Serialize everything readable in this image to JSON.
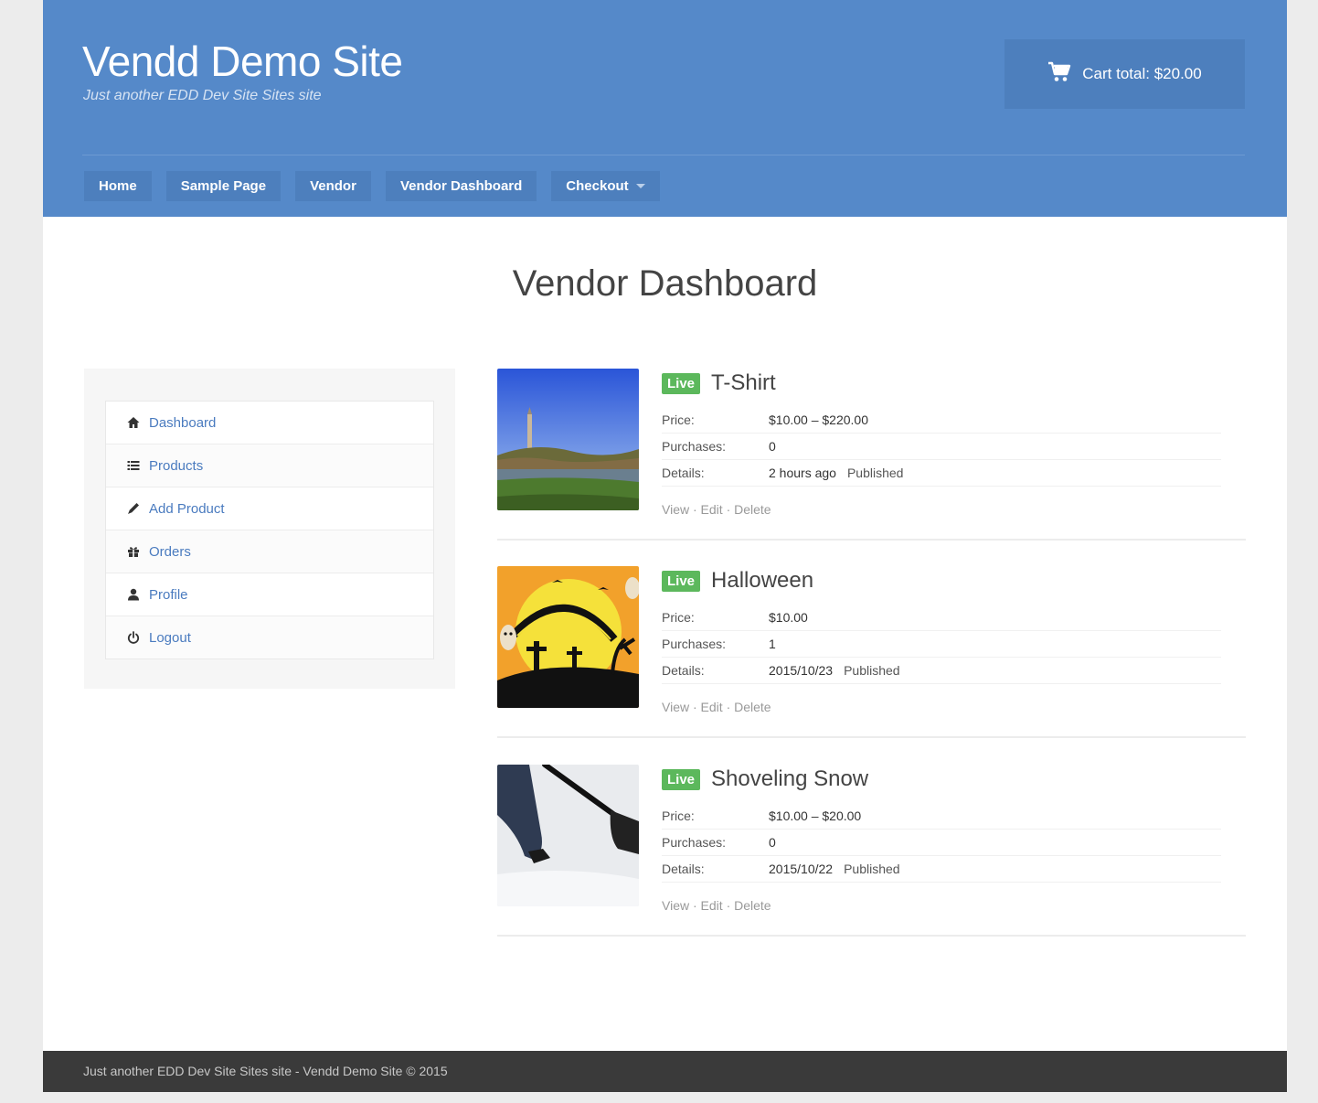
{
  "header": {
    "site_title": "Vendd Demo Site",
    "tagline": "Just another EDD Dev Site Sites site",
    "cart_total": "Cart total: $20.00",
    "cart_icon": "shopping-cart-icon",
    "bg_color": "#5589c9"
  },
  "nav": {
    "items": [
      "Home",
      "Sample Page",
      "Vendor",
      "Vendor Dashboard",
      "Checkout"
    ]
  },
  "page_title": "Vendor Dashboard",
  "sidebar": {
    "items": [
      {
        "label": "Dashboard",
        "icon": "home-icon"
      },
      {
        "label": "Products",
        "icon": "list-icon"
      },
      {
        "label": "Add Product",
        "icon": "pencil-icon"
      },
      {
        "label": "Orders",
        "icon": "gift-icon"
      },
      {
        "label": "Profile",
        "icon": "user-icon"
      },
      {
        "label": "Logout",
        "icon": "power-icon"
      }
    ]
  },
  "labels": {
    "price": "Price:",
    "purchases": "Purchases:",
    "details": "Details:",
    "view": "View",
    "edit": "Edit",
    "delete": "Delete",
    "sep": "·"
  },
  "products": [
    {
      "status": "Live",
      "name": "T-Shirt",
      "price": "$10.00 – $220.00",
      "purchases": "0",
      "date": "2 hours ago",
      "state": "Published"
    },
    {
      "status": "Live",
      "name": "Halloween",
      "price": "$10.00",
      "purchases": "1",
      "date": "2015/10/23",
      "state": "Published"
    },
    {
      "status": "Live",
      "name": "Shoveling Snow",
      "price": "$10.00 – $20.00",
      "purchases": "0",
      "date": "2015/10/22",
      "state": "Published"
    }
  ],
  "footer": {
    "text": "Just another EDD Dev Site Sites site - Vendd Demo Site © 2015"
  },
  "colors": {
    "live_badge": "#5cb85c",
    "link": "#4a7bbf",
    "footer_bg": "#3a3a3a"
  }
}
